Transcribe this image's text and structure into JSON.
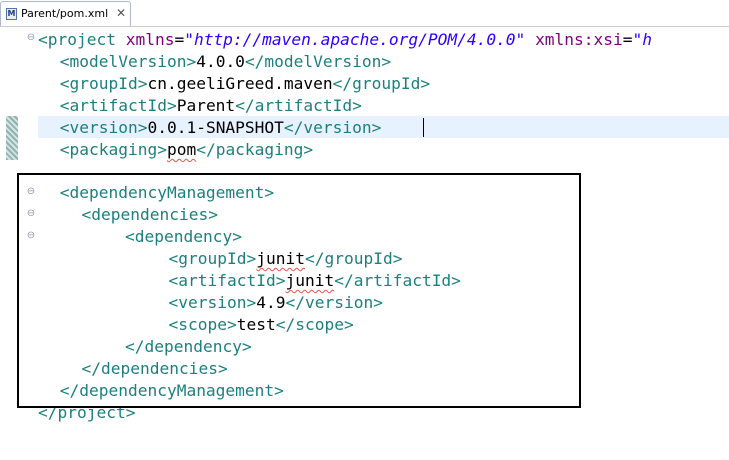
{
  "tab": {
    "icon": "M",
    "title": "Parent/pom.xml",
    "close": "✕"
  },
  "lines": [
    {
      "indent": "",
      "parts": [
        {
          "t": "tag",
          "v": "<project "
        },
        {
          "t": "attr",
          "v": "xmlns"
        },
        {
          "t": "txt",
          "v": "="
        },
        {
          "t": "val",
          "v": "\"http://maven.apache.org/POM/4.0.0\""
        },
        {
          "t": "txt",
          "v": " "
        },
        {
          "t": "attr",
          "v": "xmlns:xsi"
        },
        {
          "t": "txt",
          "v": "="
        },
        {
          "t": "val",
          "v": "\"h"
        }
      ]
    },
    {
      "indent": "  ",
      "parts": [
        {
          "t": "tag",
          "v": "<modelVersion>"
        },
        {
          "t": "txt",
          "v": "4.0.0"
        },
        {
          "t": "tag",
          "v": "</modelVersion>"
        }
      ]
    },
    {
      "indent": "  ",
      "parts": [
        {
          "t": "tag",
          "v": "<groupId>"
        },
        {
          "t": "txt",
          "v": "cn.geeliGreed.maven"
        },
        {
          "t": "tag",
          "v": "</groupId>"
        }
      ]
    },
    {
      "indent": "  ",
      "parts": [
        {
          "t": "tag",
          "v": "<artifactId>"
        },
        {
          "t": "txt",
          "v": "Parent"
        },
        {
          "t": "tag",
          "v": "</artifactId>"
        }
      ]
    },
    {
      "indent": "  ",
      "parts": [
        {
          "t": "tag",
          "v": "<version>"
        },
        {
          "t": "txt",
          "v": "0.0.1-SNAPSHOT"
        },
        {
          "t": "tag",
          "v": "</version>"
        }
      ]
    },
    {
      "indent": "  ",
      "parts": [
        {
          "t": "tag",
          "v": "<packaging>"
        },
        {
          "t": "txt",
          "v": "pom",
          "squig": true
        },
        {
          "t": "tag",
          "v": "</packaging>"
        }
      ]
    },
    {
      "indent": "",
      "parts": []
    },
    {
      "indent": "  ",
      "parts": [
        {
          "t": "tag",
          "v": "<dependencyManagement>"
        }
      ]
    },
    {
      "indent": "    ",
      "parts": [
        {
          "t": "tag",
          "v": "<dependencies>"
        }
      ]
    },
    {
      "indent": "        ",
      "parts": [
        {
          "t": "tag",
          "v": "<dependency>"
        }
      ]
    },
    {
      "indent": "            ",
      "parts": [
        {
          "t": "tag",
          "v": "<groupId>"
        },
        {
          "t": "txt",
          "v": "junit",
          "squig": true
        },
        {
          "t": "tag",
          "v": "</groupId>"
        }
      ]
    },
    {
      "indent": "            ",
      "parts": [
        {
          "t": "tag",
          "v": "<artifactId>"
        },
        {
          "t": "txt",
          "v": "junit",
          "squig": true
        },
        {
          "t": "tag",
          "v": "</artifactId>"
        }
      ]
    },
    {
      "indent": "            ",
      "parts": [
        {
          "t": "tag",
          "v": "<version>"
        },
        {
          "t": "txt",
          "v": "4.9"
        },
        {
          "t": "tag",
          "v": "</version>"
        }
      ]
    },
    {
      "indent": "            ",
      "parts": [
        {
          "t": "tag",
          "v": "<scope>"
        },
        {
          "t": "txt",
          "v": "test"
        },
        {
          "t": "tag",
          "v": "</scope>"
        }
      ]
    },
    {
      "indent": "        ",
      "parts": [
        {
          "t": "tag",
          "v": "</dependency>"
        }
      ]
    },
    {
      "indent": "    ",
      "parts": [
        {
          "t": "tag",
          "v": "</dependencies>"
        }
      ]
    },
    {
      "indent": "  ",
      "parts": [
        {
          "t": "tag",
          "v": "</dependencyManagement>"
        }
      ]
    },
    {
      "indent": "",
      "parts": [
        {
          "t": "tag",
          "v": "</project>"
        }
      ]
    }
  ],
  "fold_icons": [
    "collapse-icon",
    "collapse-icon",
    "collapse-icon",
    "collapse-icon"
  ],
  "colors": {
    "tag": "#1d7f7f",
    "attribute": "#7f007f",
    "value": "#2a00ff",
    "text": "#000000",
    "current_line": "#e8f2fe"
  }
}
